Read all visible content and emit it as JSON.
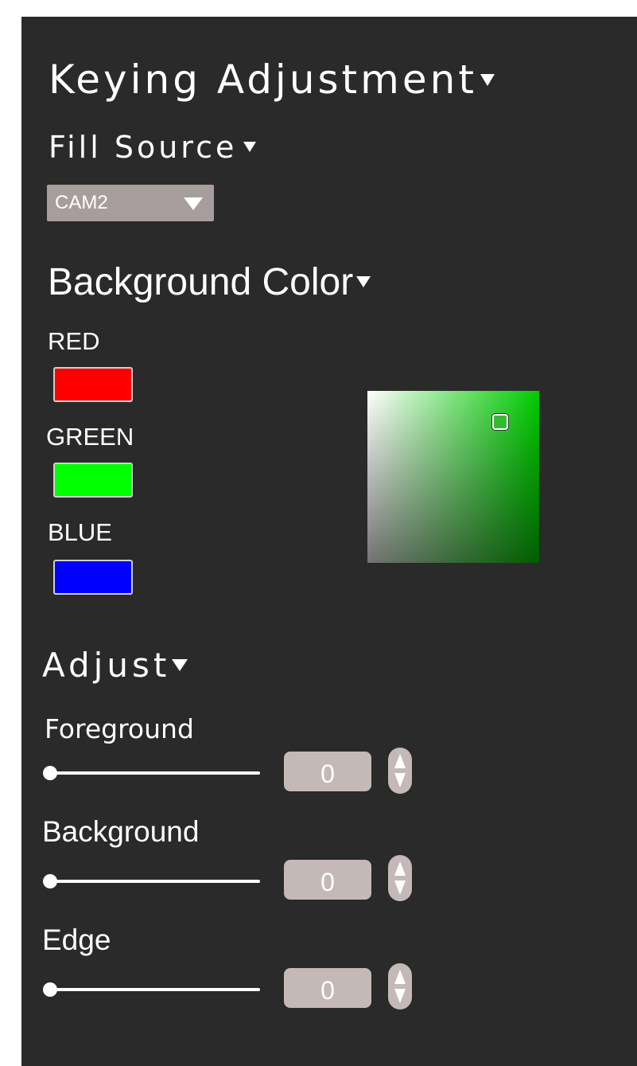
{
  "keying": {
    "title": "Keying Adjustment"
  },
  "fill_source": {
    "title": "Fill Source",
    "selected": "CAM2"
  },
  "background_color": {
    "title": "Background Color",
    "channels": [
      {
        "label": "RED",
        "color": "#ff0000"
      },
      {
        "label": "GREEN",
        "color": "#00ff00"
      },
      {
        "label": "BLUE",
        "color": "#0000ff"
      }
    ],
    "picker_hue": "#00cc00"
  },
  "adjust": {
    "title": "Adjust",
    "controls": [
      {
        "label": "Foreground",
        "value": "0"
      },
      {
        "label": "Background",
        "value": "0"
      },
      {
        "label": "Edge",
        "value": "0"
      }
    ]
  },
  "icons": {
    "dropdown": "caret-down-icon",
    "spinner": "up-down-spinner-icon"
  }
}
